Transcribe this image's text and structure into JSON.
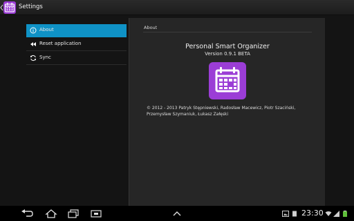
{
  "actionbar": {
    "title": "Settings"
  },
  "menu": {
    "items": [
      {
        "label": "About",
        "icon": "info-icon",
        "active": true
      },
      {
        "label": "Reset application",
        "icon": "rewind-icon",
        "active": false
      },
      {
        "label": "Sync",
        "icon": "sync-icon",
        "active": false
      }
    ]
  },
  "about": {
    "header": "About",
    "app_name": "Personal Smart Organizer",
    "version": "Version 0.9.1 BETA",
    "credits_line1": "© 2012 - 2013 Patryk Stępniewski, Radosław Macewicz, Piotr Szaciński,",
    "credits_line2": "Przemysław Szymaniuk, Łukasz Załęski"
  },
  "status": {
    "time": "23:30"
  },
  "colors": {
    "accent": "#0f92c6",
    "app_icon": "#9b3dd6"
  }
}
